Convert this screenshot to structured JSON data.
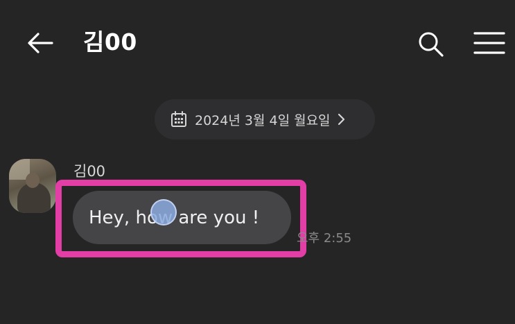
{
  "header": {
    "title": "김00",
    "icons": {
      "back": "arrow-left-icon",
      "search": "search-icon",
      "menu": "hamburger-menu-icon"
    }
  },
  "date_divider": {
    "label": "2024년 3월 4일 월요일",
    "icon": "calendar-icon",
    "chevron": "chevron-right-icon"
  },
  "messages": [
    {
      "sender": "김00",
      "text": "Hey, how are you !",
      "time": "오후 2:55",
      "highlighted": true
    }
  ],
  "colors": {
    "background": "#252526",
    "bubble": "#454548",
    "highlight": "#e23ea6",
    "date_pill": "#2e2e30"
  }
}
